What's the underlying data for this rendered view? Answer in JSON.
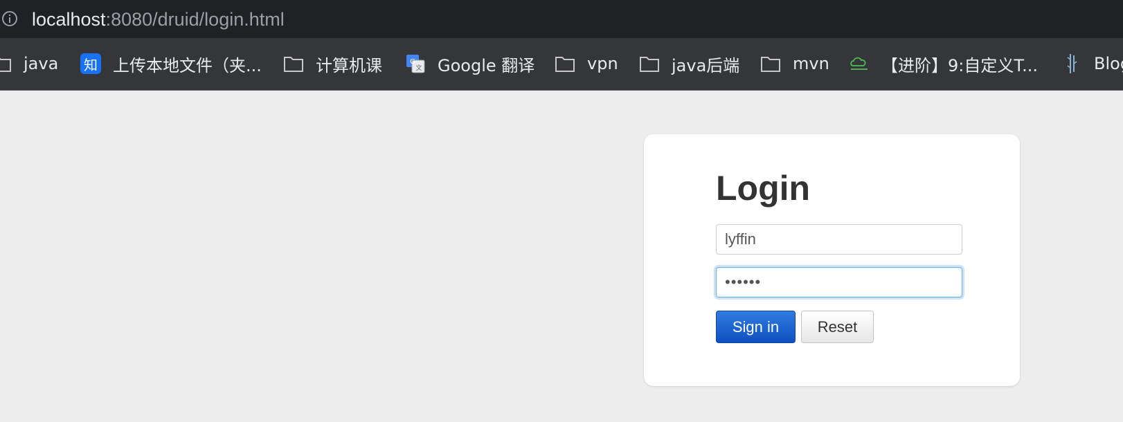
{
  "browser": {
    "url_host": "localhost",
    "url_rest": ":8080/druid/login.html"
  },
  "bookmarks": [
    {
      "label": "java",
      "icon": "folder-icon"
    },
    {
      "label": "上传本地文件（夹...",
      "icon": "zhihu-icon",
      "badge": "知"
    },
    {
      "label": "计算机课",
      "icon": "folder-icon"
    },
    {
      "label": "Google 翻译",
      "icon": "google-translate-icon"
    },
    {
      "label": "vpn",
      "icon": "folder-icon"
    },
    {
      "label": "java后端",
      "icon": "folder-icon"
    },
    {
      "label": "mvn",
      "icon": "folder-icon"
    },
    {
      "label": "【进阶】9:自定义T...",
      "icon": "cloud-logo-icon"
    },
    {
      "label": "Blog",
      "icon": "bamboo-icon"
    }
  ],
  "login": {
    "title": "Login",
    "username_value": "lyffin",
    "password_value": "••••••",
    "signin_label": "Sign in",
    "reset_label": "Reset"
  },
  "colors": {
    "url_bar_bg": "#202124",
    "bookmarks_bg": "#35363a",
    "page_bg": "#ededed",
    "primary_button": "#1a5fd0",
    "focus_ring": "#66afe9"
  }
}
